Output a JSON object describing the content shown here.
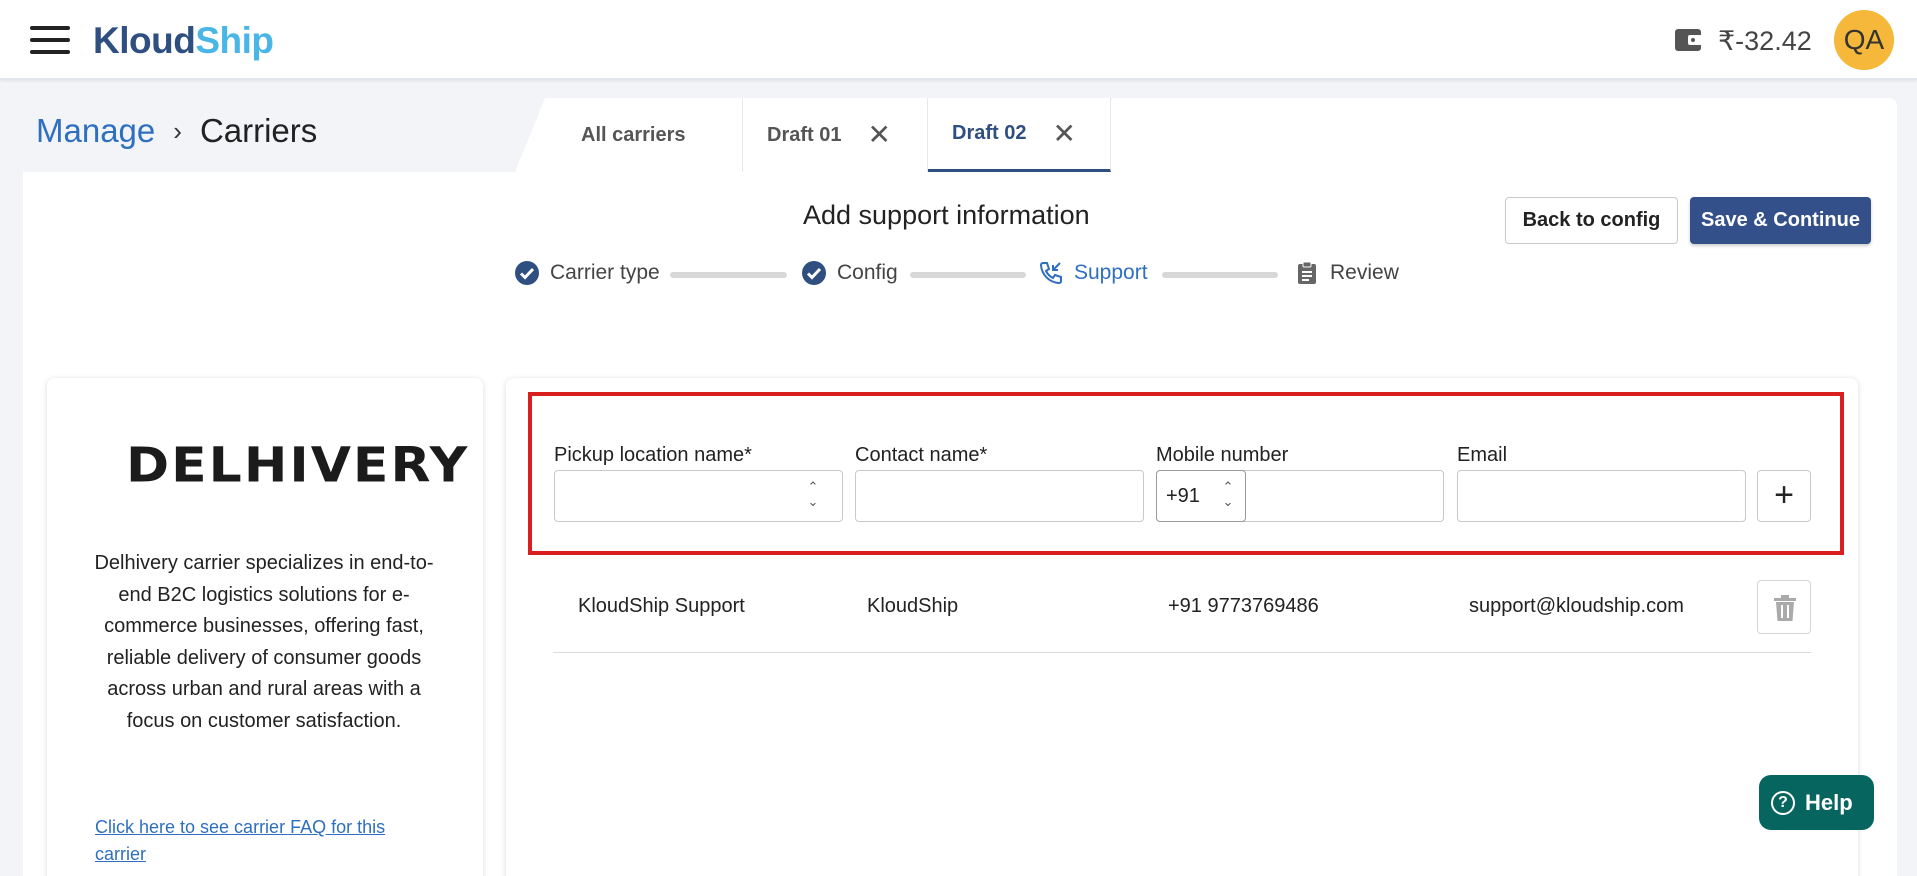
{
  "header": {
    "logo_part1": "Kloud",
    "logo_part2": "Ship",
    "balance": "₹-32.42",
    "avatar_initials": "QA"
  },
  "breadcrumb": {
    "parent": "Manage",
    "separator": "›",
    "current": "Carriers"
  },
  "tabs": [
    {
      "label": "All carriers",
      "active": false
    },
    {
      "label": "Draft 01",
      "active": false,
      "closable": true
    },
    {
      "label": "Draft 02",
      "active": true,
      "closable": true
    }
  ],
  "page": {
    "title": "Add support information",
    "back_label": "Back to config",
    "save_label": "Save & Continue"
  },
  "stepper": [
    {
      "label": "Carrier type",
      "status": "done"
    },
    {
      "label": "Config",
      "status": "done"
    },
    {
      "label": "Support",
      "status": "active"
    },
    {
      "label": "Review",
      "status": "pending"
    }
  ],
  "carrier": {
    "logo_text": "DELHIVERY",
    "description": "Delhivery carrier specializes in end-to-end B2C logistics solutions for e-commerce businesses, offering fast, reliable delivery of consumer goods across urban and rural areas with a focus on customer satisfaction.",
    "faq_link": "Click here to see carrier FAQ for this carrier"
  },
  "form": {
    "pickup_label": "Pickup location name*",
    "contact_label": "Contact name*",
    "mobile_label": "Mobile number",
    "email_label": "Email",
    "country_code": "+91",
    "add_symbol": "+"
  },
  "contacts": [
    {
      "pickup": "KloudShip Support",
      "contact": "KloudShip",
      "mobile": "+91 9773769486",
      "email": "support@kloudship.com"
    }
  ],
  "help": {
    "label": "Help"
  },
  "colors": {
    "primary": "#34508a",
    "link": "#2e6fbf",
    "highlight": "#d91e1e",
    "help": "#06665f",
    "avatar": "#f5b83a"
  }
}
